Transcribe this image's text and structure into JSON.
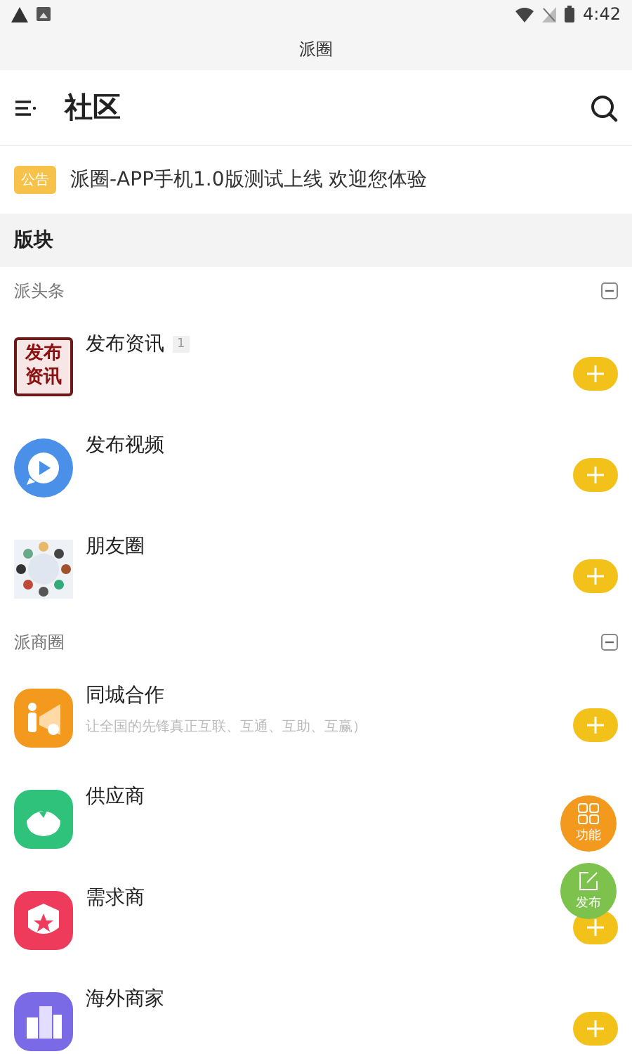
{
  "status_bar": {
    "time": "4:42"
  },
  "window": {
    "title": "派圈"
  },
  "header": {
    "title": "社区"
  },
  "notice": {
    "tag": "公告",
    "text": "派圈-APP手机1.0版测试上线 欢迎您体验"
  },
  "section": {
    "title": "版块"
  },
  "groups": [
    {
      "title": "派头条",
      "expanded": true,
      "items": [
        {
          "kind": "text-logo",
          "logo_text": "发布资讯",
          "title": "发布资讯",
          "badge": "1",
          "add_button": true
        },
        {
          "kind": "video",
          "title": "发布视频",
          "add_button": true
        },
        {
          "kind": "friends",
          "title": "朋友圈",
          "add_button": true
        }
      ]
    },
    {
      "title": "派商圈",
      "expanded": true,
      "items": [
        {
          "kind": "city",
          "title": "同城合作",
          "subtitle": "让全国的先锋真正互联、互通、互助、互赢）",
          "add_button": true
        },
        {
          "kind": "supplier",
          "title": "供应商",
          "add_button": false
        },
        {
          "kind": "demand",
          "title": "需求商",
          "add_button": true
        },
        {
          "kind": "overseas",
          "title": "海外商家",
          "add_button": true
        }
      ]
    }
  ],
  "fabs": [
    {
      "kind": "grid",
      "label": "功能"
    },
    {
      "kind": "edit",
      "label": "发布"
    }
  ]
}
